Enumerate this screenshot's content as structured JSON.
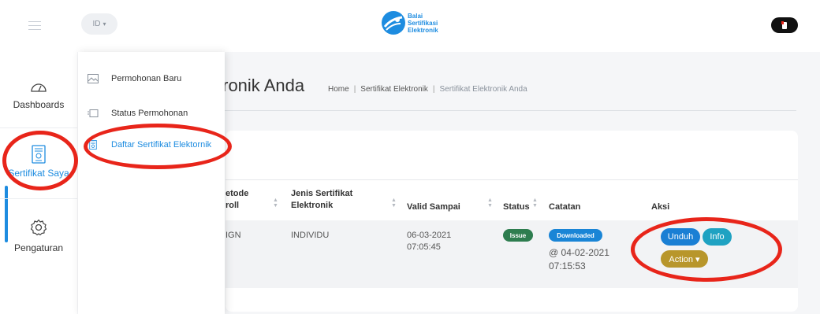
{
  "header": {
    "lang": "ID",
    "lang_caret": "▾",
    "brand_line1": "Balai",
    "brand_line2": "Sertifikasi",
    "brand_line3": "Elektronik"
  },
  "sidebar": {
    "items": [
      {
        "label": "Dashboards",
        "icon": "dashboard-gauge-icon"
      },
      {
        "label": "Sertifikat Saya",
        "icon": "certificate-icon"
      },
      {
        "label": "Pengaturan",
        "icon": "gear-icon"
      }
    ]
  },
  "submenu": {
    "items": [
      {
        "label": "Permohonan Baru"
      },
      {
        "label": "Status Permohonan"
      },
      {
        "label": "Daftar Sertifikat Elektornik"
      }
    ]
  },
  "page": {
    "title": "tronik Anda",
    "breadcrumb": [
      "Home",
      "Sertifikat Elektronik",
      "Sertifikat Elektronik Anda"
    ],
    "separator": "|"
  },
  "table": {
    "headers": {
      "metode1": "etode",
      "metode2": "roll",
      "jenis1": "Jenis Sertifikat",
      "jenis2": "Elektronik",
      "valid": "Valid Sampai",
      "status": "Status",
      "catatan": "Catatan",
      "aksi": "Aksi"
    },
    "row": {
      "metode": "IGN",
      "jenis": "INDIVIDU",
      "valid_date": "06-03-2021",
      "valid_time": "07:05:45",
      "status": "Issue",
      "catatan_badge": "Downloaded",
      "catatan_date": "@ 04-02-2021",
      "catatan_time": "07:15:53",
      "btn_unduh": "Unduh",
      "btn_info": "Info",
      "btn_action": "Action ▾"
    }
  },
  "colors": {
    "accent": "#1d8ce0",
    "issue_badge": "#2e7d4f",
    "downloaded_badge": "#1a85d6",
    "unduh": "#1a7fd4",
    "info": "#1fa2c2",
    "action": "#b8962b",
    "annotation": "#e8251a"
  }
}
